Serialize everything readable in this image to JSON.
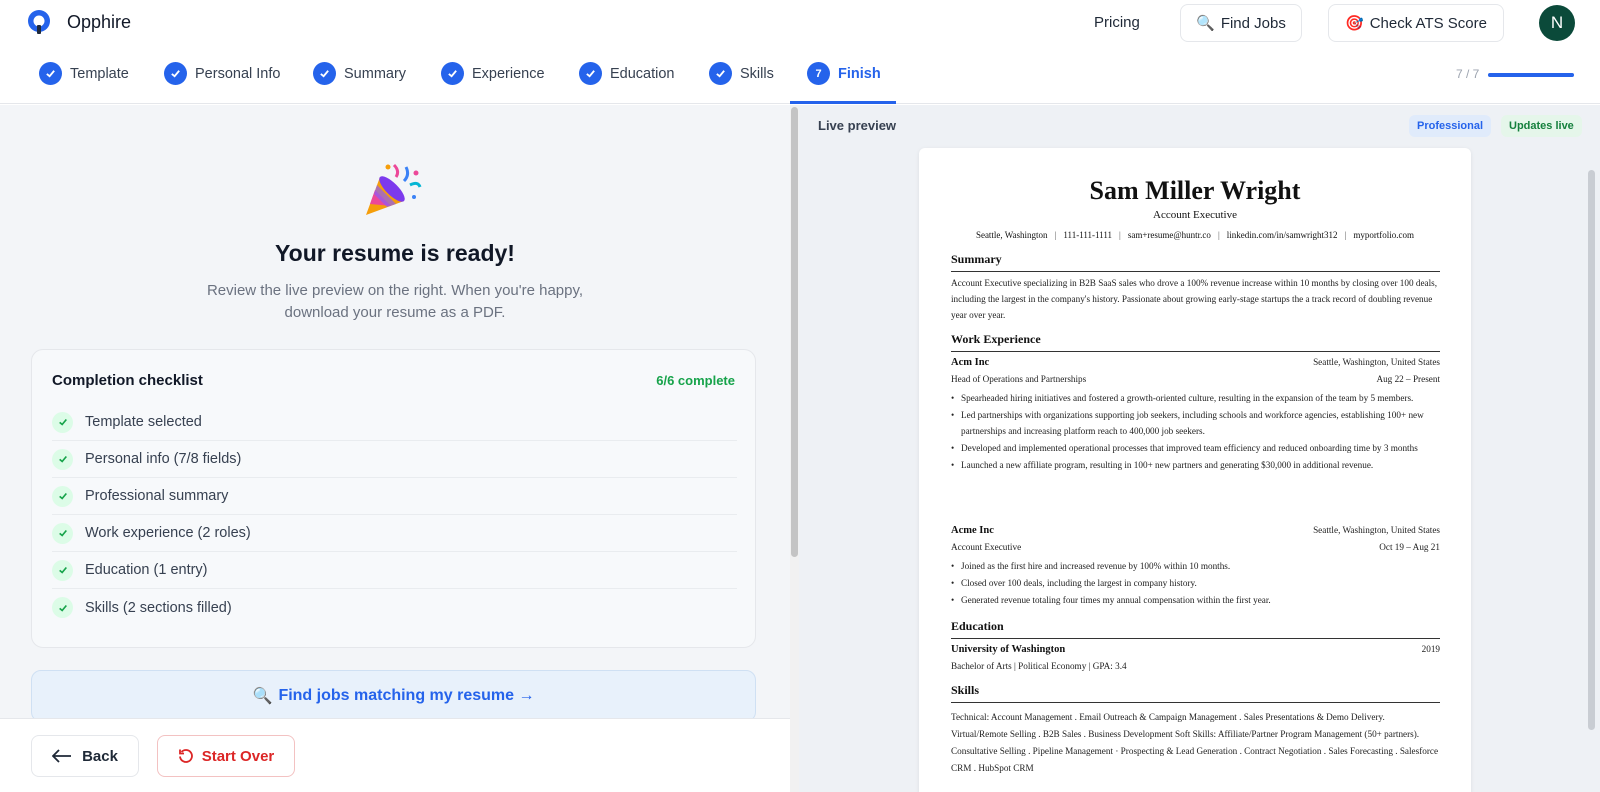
{
  "app": {
    "name": "Opphire"
  },
  "header": {
    "pricing": "Pricing",
    "find_jobs": "Find Jobs",
    "check_ats": "Check ATS Score",
    "avatar_initial": "N"
  },
  "steps": {
    "items": [
      {
        "label": "Template",
        "state": "done"
      },
      {
        "label": "Personal Info",
        "state": "done"
      },
      {
        "label": "Summary",
        "state": "done"
      },
      {
        "label": "Experience",
        "state": "done"
      },
      {
        "label": "Education",
        "state": "done"
      },
      {
        "label": "Skills",
        "state": "done"
      },
      {
        "label": "Finish",
        "state": "active",
        "number": "7"
      }
    ],
    "progress_text": "7 / 7",
    "progress_fraction": 1.0
  },
  "left": {
    "title": "Your resume is ready!",
    "subtitle": "Review the live preview on the right. When you're happy, download your resume as a PDF.",
    "checklist": {
      "title": "Completion checklist",
      "status": "6/6 complete",
      "items": [
        "Template selected",
        "Personal info (7/8 fields)",
        "Professional summary",
        "Work experience (2 roles)",
        "Education (1 entry)",
        "Skills (2 sections filled)"
      ]
    },
    "find_match": "Find jobs matching my resume →",
    "back": "Back",
    "start_over": "Start Over"
  },
  "preview": {
    "label": "Live preview",
    "badge_template": "Professional",
    "badge_live": "Updates live",
    "resume": {
      "name": "Sam Miller Wright",
      "title": "Account Executive",
      "contact": [
        "Seattle, Washington",
        "111-111-1111",
        "sam+resume@huntr.co",
        "linkedin.com/in/samwright312",
        "myportfolio.com"
      ],
      "summary_heading": "Summary",
      "summary": "Account Executive specializing in B2B SaaS sales who drove a 100% revenue increase within 10 months by closing over 100 deals, including the largest in the company's history. Passionate about growing early-stage startups the a track record of doubling revenue year over year.",
      "experience_heading": "Work Experience",
      "jobs": [
        {
          "company": "Acm Inc",
          "location": "Seattle, Washington, United States",
          "role": "Head of Operations and Partnerships",
          "dates": "Aug 22 – Present",
          "bullets": [
            "Spearheaded hiring initiatives and fostered a growth-oriented culture, resulting in the expansion of the team by 5 members.",
            "Led partnerships with organizations supporting job seekers, including schools and workforce agencies, establishing 100+ new partnerships and increasing platform reach to 400,000 job seekers.",
            "Developed and implemented operational processes that improved team efficiency and reduced onboarding time by 3 months",
            "Launched a new affiliate program, resulting in 100+ new partners and generating $30,000 in additional revenue."
          ]
        },
        {
          "company": "Acme Inc",
          "location": "Seattle, Washington, United States",
          "role": "Account Executive",
          "dates": "Oct 19 – Aug 21",
          "bullets": [
            "Joined as the first hire and increased revenue by 100% within 10 months.",
            "Closed over 100 deals, including the largest in company history.",
            "Generated revenue totaling four times my annual compensation within the first year."
          ]
        }
      ],
      "education_heading": "Education",
      "school": "University of Washington",
      "school_year": "2019",
      "degree": "Bachelor of Arts | Political Economy | GPA: 3.4",
      "skills_heading": "Skills",
      "skills": "Technical: Account Management . Email Outreach & Campaign Management . Sales Presentations & Demo Delivery. Virtual/Remote Selling . B2B Sales . Business Development Soft Skills: Affiliate/Partner Program Management (50+ partners). Consultative Selling . Pipeline Management · Prospecting & Lead Generation . Contract Negotiation . Sales Forecasting . Salesforce CRM . HubSpot CRM"
    }
  },
  "colors": {
    "accent": "#2563eb",
    "success": "#16a34a",
    "danger": "#dc2626",
    "avatar": "#0b4a3a"
  },
  "icons": {
    "logo": "opphire-logo-icon",
    "search": "search-icon",
    "target": "target-icon",
    "check": "check-icon",
    "party": "party-popper-icon",
    "back": "arrow-left-icon",
    "restart": "restart-icon"
  }
}
